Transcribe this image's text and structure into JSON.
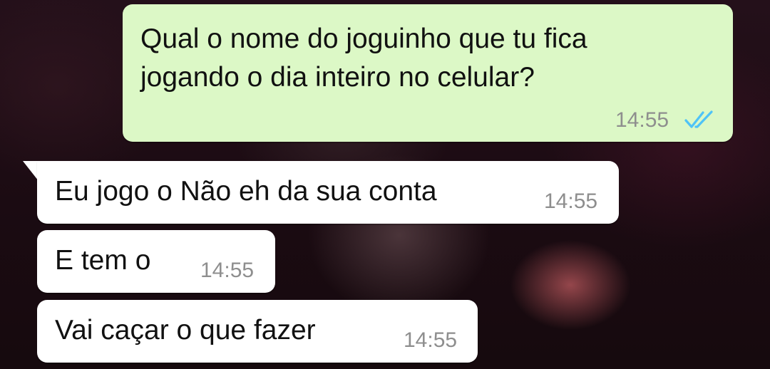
{
  "chat": {
    "messages": [
      {
        "direction": "outgoing",
        "lines": [
          "Qual o nome do joguinho que tu fica",
          "jogando o dia inteiro no celular?"
        ],
        "time": "14:55",
        "status": "read",
        "status_icon": "double-check-icon",
        "status_color": "#4fc3f7"
      },
      {
        "direction": "incoming",
        "text": "Eu jogo o Não eh da sua conta",
        "time": "14:55"
      },
      {
        "direction": "incoming",
        "text": "E tem o",
        "time": "14:55"
      },
      {
        "direction": "incoming",
        "text": "Vai caçar o que fazer",
        "time": "14:55"
      }
    ]
  },
  "colors": {
    "outgoing_bubble": "#dcf8c6",
    "incoming_bubble": "#ffffff",
    "timestamp": "#8e8e8e"
  }
}
